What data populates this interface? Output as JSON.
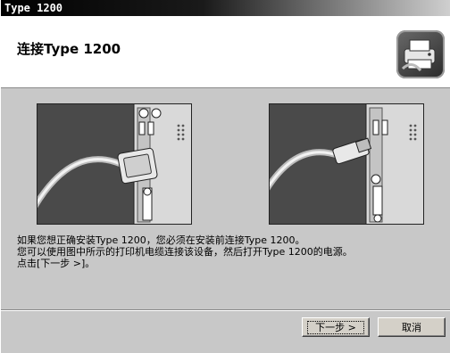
{
  "window": {
    "title": "Type 1200"
  },
  "header": {
    "title": "连接Type 1200"
  },
  "logo": {
    "icon": "printer-icon"
  },
  "illustrations": [
    {
      "name": "parallel-cable-illustration"
    },
    {
      "name": "usb-cable-illustration"
    }
  ],
  "message": {
    "line1": "如果您想正确安装Type  1200，您必须在安装前连接Type  1200。",
    "line2": "您可以使用图中所示的打印机电缆连接该设备，然后打开Type 1200的电源。",
    "line3": "点击[下一步  >]。"
  },
  "buttons": {
    "next_label": "下一步 >",
    "cancel_label": "取消"
  },
  "colors": {
    "window_bg": "#c8c8c8",
    "title_bar": "#000000",
    "panel": "#ffffff"
  }
}
